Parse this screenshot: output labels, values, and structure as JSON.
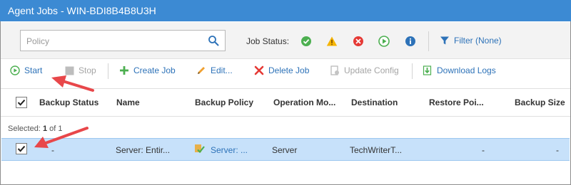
{
  "window": {
    "title": "Agent Jobs - WIN-BDI8B4B8U3H"
  },
  "search": {
    "placeholder": "Policy",
    "value": ""
  },
  "job_status": {
    "label": "Job Status:",
    "filters": [
      {
        "icon": "success-icon",
        "color": "#4caf50"
      },
      {
        "icon": "warning-icon",
        "color": "#f5b400"
      },
      {
        "icon": "error-icon",
        "color": "#e53935"
      },
      {
        "icon": "running-icon",
        "color": "#4caf50"
      },
      {
        "icon": "info-icon",
        "color": "#2d72b8"
      }
    ]
  },
  "filter": {
    "label": "Filter (None)"
  },
  "toolbar": {
    "start": "Start",
    "stop": "Stop",
    "create_job": "Create Job",
    "edit": "Edit...",
    "delete_job": "Delete Job",
    "update_config": "Update Config",
    "download_logs": "Download Logs"
  },
  "table": {
    "columns": [
      "Backup Status",
      "Name",
      "Backup Policy",
      "Operation Mo...",
      "Destination",
      "Restore Poi...",
      "Backup Size"
    ],
    "selected_label": "Selected:",
    "selected_count": "1",
    "selected_of": "of 1",
    "rows": [
      {
        "checked": true,
        "backup_status": "-",
        "name": "Server: Entir...",
        "backup_policy": "Server: ...",
        "operation_mode": "Server",
        "destination": "TechWriterT...",
        "restore_points": "-",
        "backup_size": "-"
      }
    ]
  },
  "colors": {
    "title_bar": "#3c8ad3",
    "link": "#2d72b8",
    "selection": "#c7e1fa",
    "annotation_arrow": "#e8474a"
  }
}
